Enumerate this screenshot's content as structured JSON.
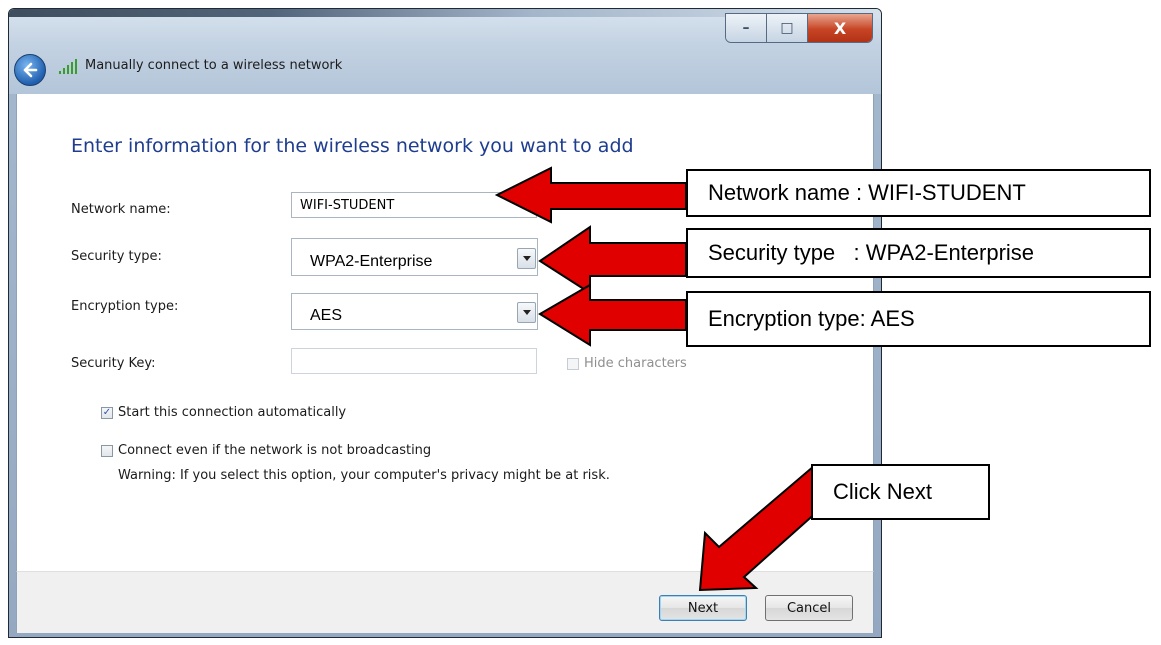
{
  "window": {
    "title": "Manually connect to a wireless network",
    "controls": {
      "minimize": "–",
      "maximize": "□",
      "close": "X"
    }
  },
  "form": {
    "heading": "Enter information for the wireless network you want to add",
    "network_name": {
      "label": "Network name:",
      "value": "WIFI-STUDENT"
    },
    "security_type": {
      "label": "Security type:",
      "value": "WPA2-Enterprise"
    },
    "encryption_type": {
      "label": "Encryption type:",
      "value": "AES"
    },
    "security_key": {
      "label": "Security Key:",
      "value": "",
      "hide_characters_label": "Hide characters",
      "hide_characters_checked": false
    },
    "start_automatically": {
      "label": "Start this connection automatically",
      "checked": true
    },
    "connect_not_broadcasting": {
      "label": "Connect even if the network is not broadcasting",
      "checked": false
    },
    "warning": "Warning: If you select this option, your computer's privacy might be at risk."
  },
  "buttons": {
    "next": "Next",
    "cancel": "Cancel"
  },
  "annotations": {
    "network_name": "Network name : WIFI-STUDENT",
    "security_type": "Security type   : WPA2-Enterprise",
    "encryption_type": "Encryption type: AES",
    "click_next": "Click Next"
  },
  "colors": {
    "arrow_fill": "#e00000",
    "heading": "#1e3d8f",
    "close_button": "#c74525"
  },
  "icons": [
    "back-arrow-icon",
    "wireless-signal-icon",
    "dropdown-arrow-icon",
    "checkmark-icon"
  ]
}
